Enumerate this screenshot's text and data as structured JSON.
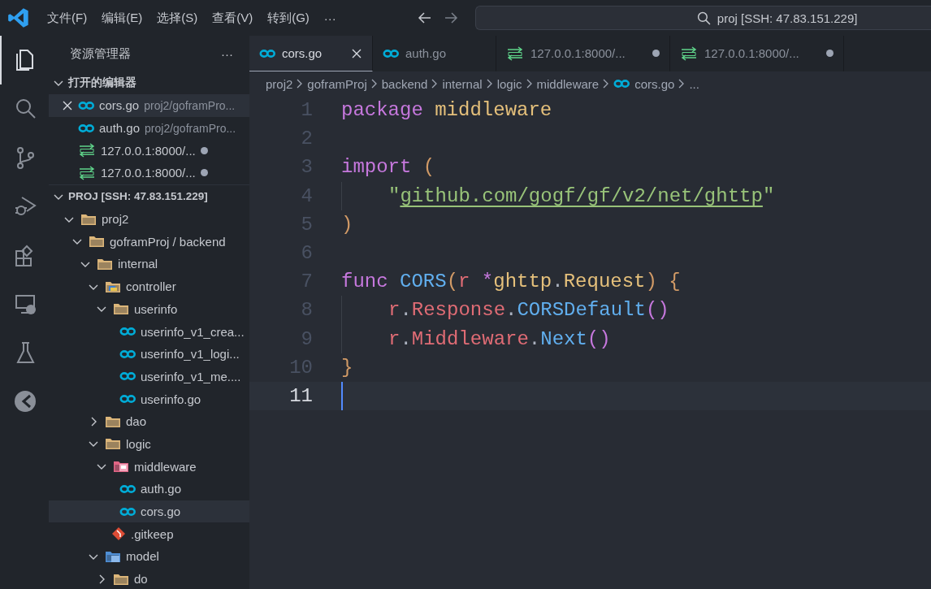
{
  "title_bar": {
    "menu": [
      "文件(F)",
      "编辑(E)",
      "选择(S)",
      "查看(V)",
      "转到(G)"
    ],
    "menu_more": "···",
    "search": {
      "value": "proj [SSH: 47.83.151.229]"
    }
  },
  "activity_bar": [
    {
      "kind": "explorer",
      "selected": true
    },
    {
      "kind": "search",
      "selected": false
    },
    {
      "kind": "source-control",
      "selected": false
    },
    {
      "kind": "run-debug",
      "selected": false
    },
    {
      "kind": "extensions",
      "selected": false
    },
    {
      "kind": "remote",
      "selected": false
    },
    {
      "kind": "testing",
      "selected": false
    },
    {
      "kind": "pie",
      "selected": false
    }
  ],
  "sidebar": {
    "title": "资源管理器",
    "more": "···",
    "open_editors": {
      "title": "打开的编辑器",
      "expanded": true,
      "items": [
        {
          "name": "cors.go",
          "path": "proj2/goframPro...",
          "kind": "go",
          "selected": true,
          "dirty": false
        },
        {
          "name": "auth.go",
          "path": "proj2/goframPro...",
          "kind": "go",
          "selected": false,
          "dirty": false
        },
        {
          "name": "127.0.0.1:8000/...",
          "kind": "http",
          "selected": false,
          "dirty": true
        },
        {
          "name": "127.0.0.1:8000/...",
          "kind": "http",
          "selected": false,
          "dirty": true
        }
      ]
    },
    "workspace": {
      "title": "PROJ [SSH: 47.83.151.229]",
      "expanded": true,
      "tree": [
        {
          "name": "proj2",
          "kind": "folder",
          "expanded": true,
          "selected": false,
          "children": [
            {
              "name": "goframProj / backend",
              "kind": "folder",
              "expanded": true,
              "selected": false,
              "children": [
                {
                  "name": "internal",
                  "kind": "folder",
                  "expanded": true,
                  "selected": false,
                  "children": [
                    {
                      "name": "controller",
                      "kind": "folder-controller",
                      "expanded": true,
                      "selected": false,
                      "children": [
                        {
                          "name": "userinfo",
                          "kind": "folder",
                          "expanded": true,
                          "selected": false,
                          "children": [
                            {
                              "name": "userinfo_v1_crea...",
                              "kind": "go",
                              "selected": false
                            },
                            {
                              "name": "userinfo_v1_logi...",
                              "kind": "go",
                              "selected": false
                            },
                            {
                              "name": "userinfo_v1_me....",
                              "kind": "go",
                              "selected": false
                            },
                            {
                              "name": "userinfo.go",
                              "kind": "go",
                              "selected": false
                            }
                          ]
                        }
                      ]
                    },
                    {
                      "name": "dao",
                      "kind": "folder",
                      "expanded": false,
                      "selected": false
                    },
                    {
                      "name": "logic",
                      "kind": "folder",
                      "expanded": true,
                      "selected": false,
                      "children": [
                        {
                          "name": "middleware",
                          "kind": "folder-middleware",
                          "expanded": true,
                          "selected": false,
                          "children": [
                            {
                              "name": "auth.go",
                              "kind": "go",
                              "selected": false
                            },
                            {
                              "name": "cors.go",
                              "kind": "go",
                              "selected": true
                            }
                          ]
                        },
                        {
                          "name": ".gitkeep",
                          "kind": "git",
                          "selected": false
                        }
                      ]
                    },
                    {
                      "name": "model",
                      "kind": "folder-model",
                      "expanded": true,
                      "selected": false,
                      "children": [
                        {
                          "name": "do",
                          "kind": "folder",
                          "expanded": false,
                          "selected": false
                        }
                      ]
                    }
                  ]
                }
              ]
            }
          ]
        }
      ]
    }
  },
  "tabs": [
    {
      "label": "cors.go",
      "kind": "go",
      "selected": true,
      "dirty": false
    },
    {
      "label": "auth.go",
      "kind": "go",
      "selected": false,
      "dirty": false
    },
    {
      "label": "127.0.0.1:8000/...",
      "kind": "http",
      "selected": false,
      "dirty": true
    },
    {
      "label": "127.0.0.1:8000/...",
      "kind": "http",
      "selected": false,
      "dirty": true
    }
  ],
  "breadcrumb": [
    {
      "label": "proj2",
      "kind": "folder"
    },
    {
      "label": "goframProj",
      "kind": "folder"
    },
    {
      "label": "backend",
      "kind": "folder"
    },
    {
      "label": "internal",
      "kind": "folder"
    },
    {
      "label": "logic",
      "kind": "folder"
    },
    {
      "label": "middleware",
      "kind": "folder"
    },
    {
      "label": "cors.go",
      "kind": "go"
    },
    {
      "label": "...",
      "kind": "more"
    }
  ],
  "editor": {
    "lines": [
      {
        "number": "1",
        "current": false,
        "indented": false,
        "tokens": [
          {
            "kind": "keyword",
            "text": "package "
          },
          {
            "kind": "type",
            "text": "middleware"
          }
        ]
      },
      {
        "number": "2",
        "current": false,
        "indented": false
      },
      {
        "number": "3",
        "current": false,
        "indented": false,
        "tokens": [
          {
            "kind": "keyword",
            "text": "import "
          },
          {
            "kind": "bracket",
            "text": "("
          }
        ]
      },
      {
        "number": "4",
        "current": false,
        "indented": true,
        "tokens": [
          {
            "kind": "quote",
            "text": "\""
          },
          {
            "kind": "link",
            "text": "github.com/gogf/gf/v2/net/ghttp"
          },
          {
            "kind": "quote",
            "text": "\""
          }
        ]
      },
      {
        "number": "5",
        "current": false,
        "indented": false,
        "tokens": [
          {
            "kind": "bracket",
            "text": ")"
          }
        ]
      },
      {
        "number": "6",
        "current": false,
        "indented": false
      },
      {
        "number": "7",
        "current": false,
        "indented": false,
        "tokens": [
          {
            "kind": "keyword",
            "text": "func "
          },
          {
            "kind": "function",
            "text": "CORS"
          },
          {
            "kind": "bracket",
            "text": "("
          },
          {
            "kind": "variable",
            "text": "r "
          },
          {
            "kind": "keyword",
            "text": "*"
          },
          {
            "kind": "type",
            "text": "ghttp"
          },
          {
            "kind": "plain",
            "text": "."
          },
          {
            "kind": "type",
            "text": "Request"
          },
          {
            "kind": "bracket",
            "text": ") {"
          }
        ]
      },
      {
        "number": "8",
        "current": false,
        "indented": true,
        "tokens": [
          {
            "kind": "variable",
            "text": "r"
          },
          {
            "kind": "plain",
            "text": "."
          },
          {
            "kind": "variable",
            "text": "Response"
          },
          {
            "kind": "plain",
            "text": "."
          },
          {
            "kind": "function",
            "text": "CORSDefault"
          },
          {
            "kind": "bracket2",
            "text": "()"
          }
        ]
      },
      {
        "number": "9",
        "current": false,
        "indented": true,
        "tokens": [
          {
            "kind": "variable",
            "text": "r"
          },
          {
            "kind": "plain",
            "text": "."
          },
          {
            "kind": "variable",
            "text": "Middleware"
          },
          {
            "kind": "plain",
            "text": "."
          },
          {
            "kind": "function",
            "text": "Next"
          },
          {
            "kind": "bracket2",
            "text": "()"
          }
        ]
      },
      {
        "number": "10",
        "current": false,
        "indented": false,
        "tokens": [
          {
            "kind": "bracket",
            "text": "}"
          }
        ]
      },
      {
        "number": "11",
        "current": true,
        "indented": false
      }
    ]
  }
}
